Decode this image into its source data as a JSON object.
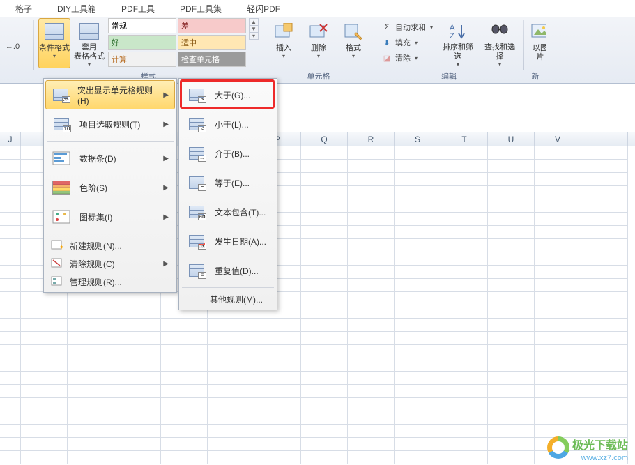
{
  "menubar": [
    "格子",
    "DIY工具箱",
    "PDF工具",
    "PDF工具集",
    "轻闪PDF"
  ],
  "ribbon": {
    "numfmt_decrease": "",
    "cond_format": "条件格式",
    "table_format": {
      "l1": "套用",
      "l2": "表格格式"
    },
    "styles": {
      "group_label": "样式",
      "cells": [
        {
          "label": "常规",
          "bg": "#ffffff",
          "color": "#333"
        },
        {
          "label": "差",
          "bg": "#f7caca",
          "color": "#8b2a2a"
        },
        {
          "label": "好",
          "bg": "#c9e7c9",
          "color": "#2c6e2c"
        },
        {
          "label": "适中",
          "bg": "#ffe7b3",
          "color": "#8a5a14"
        },
        {
          "label": "计算",
          "bg": "#f1f1f1",
          "color": "#b76b20"
        },
        {
          "label": "检查单元格",
          "bg": "#9b9b9b",
          "color": "#fff"
        }
      ]
    },
    "cells_group": {
      "label": "单元格",
      "insert": "插入",
      "delete": "删除",
      "format": "格式"
    },
    "editing_group": {
      "label": "编辑",
      "autosum": "自动求和",
      "fill": "填充",
      "clear": "清除",
      "sort": "排序和筛选",
      "find": "查找和选择"
    },
    "new_group": {
      "label": "新",
      "tool": "以图片"
    }
  },
  "menu1": {
    "highlight_rules": "突出显示单元格规则(H)",
    "top_bottom": "项目选取规则(T)",
    "data_bars": "数据条(D)",
    "color_scales": "色阶(S)",
    "icon_sets": "图标集(I)",
    "new_rule": "新建规则(N)...",
    "clear_rules": "清除规则(C)",
    "manage_rules": "管理规则(R)..."
  },
  "menu2": {
    "greater": "大于(G)...",
    "less": "小于(L)...",
    "between": "介于(B)...",
    "equal": "等于(E)...",
    "text_contains": "文本包含(T)...",
    "date": "发生日期(A)...",
    "duplicate": "重复值(D)...",
    "more": "其他规则(M)..."
  },
  "columns": [
    "J",
    "",
    "",
    "",
    "",
    "",
    "P",
    "Q",
    "R",
    "S",
    "T",
    "U",
    "V"
  ],
  "watermark": {
    "brand": "极光下载站",
    "url": "www.xz7.com"
  }
}
